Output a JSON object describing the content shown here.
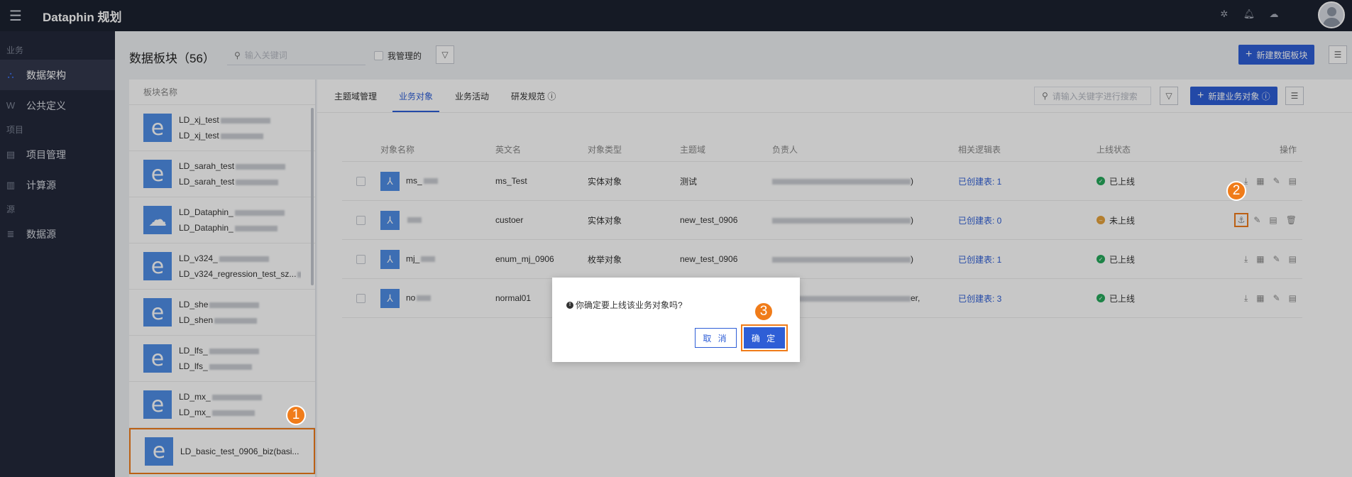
{
  "topbar": {
    "app_title": "Dataphin 规划",
    "icons": [
      "bug-icon",
      "bell-icon",
      "cloud-icon"
    ]
  },
  "sidebar": {
    "groups": [
      {
        "label": "业务",
        "items": [
          {
            "label": "数据架构",
            "icon": "sitemap-icon",
            "active": true
          },
          {
            "label": "公共定义",
            "icon": "w-icon"
          }
        ]
      },
      {
        "label": "项目",
        "items": [
          {
            "label": "项目管理",
            "icon": "folder-icon"
          },
          {
            "label": "计算源",
            "icon": "chart-icon"
          }
        ]
      },
      {
        "label": "源",
        "items": [
          {
            "label": "数据源",
            "icon": "database-icon"
          }
        ]
      }
    ]
  },
  "header": {
    "title": "数据板块（56）",
    "search_placeholder": "输入关键词",
    "checkbox_label": "我管理的",
    "new_block_btn": "新建数据板块"
  },
  "left_panel": {
    "column_header": "板块名称",
    "blocks": [
      {
        "line1": "LD_xj_test",
        "line2": "LD_xj_test",
        "icon": "e"
      },
      {
        "line1": "LD_sarah_test",
        "line2": "LD_sarah_test",
        "icon": "e"
      },
      {
        "line1": "LD_Dataphin_",
        "line2": "LD_Dataphin_",
        "icon": "cloud"
      },
      {
        "line1": "LD_v324_",
        "line2": "LD_v324_regression_test_sz...",
        "icon": "e"
      },
      {
        "line1": "LD_she",
        "line2": "LD_shen",
        "icon": "e"
      },
      {
        "line1": "LD_lfs_",
        "line2": "LD_lfs_",
        "icon": "e"
      },
      {
        "line1": "LD_mx_",
        "line2": "LD_mx_",
        "icon": "e"
      },
      {
        "line1": "LD_basic_test_0906_biz(basi...",
        "line2": "",
        "icon": "e",
        "selected": true
      }
    ]
  },
  "tabs": [
    "主题域管理",
    "业务对象",
    "业务活动",
    "研发规范 ⓘ"
  ],
  "active_tab": 1,
  "right_toolbar": {
    "search_placeholder": "请输入关键字进行搜索",
    "new_object_btn": "新建业务对象 ⓘ"
  },
  "table": {
    "headers": [
      "对象名称",
      "英文名",
      "对象类型",
      "主题域",
      "负责人",
      "相关逻辑表",
      "上线状态",
      "操作"
    ],
    "rows": [
      {
        "name": "ms_",
        "en": "ms_Test",
        "type": "实体对象",
        "domain": "测试",
        "owner": ")",
        "tables": "已创建表: 1",
        "status": "已上线",
        "online": true
      },
      {
        "name": "",
        "en": "custoer",
        "type": "实体对象",
        "domain": "new_test_0906",
        "owner": ")",
        "tables": "已创建表: 0",
        "status": "未上线",
        "online": false
      },
      {
        "name": "mj_",
        "en": "enum_mj_0906",
        "type": "枚举对象",
        "domain": "new_test_0906",
        "owner": ")",
        "tables": "已创建表: 1",
        "status": "已上线",
        "online": true
      },
      {
        "name": "no",
        "en": "normal01",
        "type": "实体对象",
        "domain": "new_test_0906",
        "owner": "er,",
        "tables": "已创建表: 3",
        "status": "已上线",
        "online": true
      }
    ]
  },
  "dialog": {
    "message": "你确定要上线该业务对象吗?",
    "cancel": "取 消",
    "ok": "确 定"
  },
  "badges": [
    "1",
    "2",
    "3"
  ],
  "colors": {
    "accent": "#2e5ed6",
    "highlight": "#f07c1a",
    "online": "#26a85b",
    "offline": "#e6a23c"
  }
}
